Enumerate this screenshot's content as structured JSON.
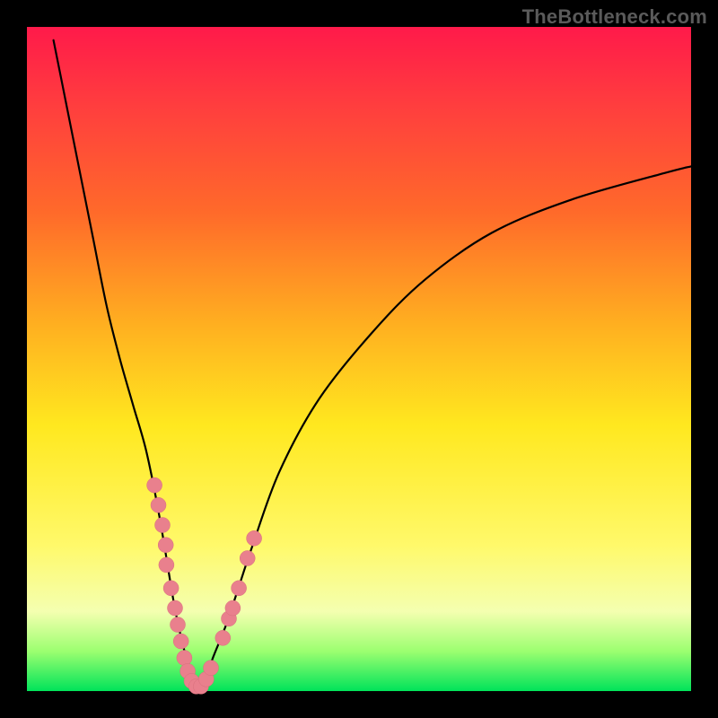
{
  "watermark": "TheBottleneck.com",
  "chart_data": {
    "type": "line",
    "title": "",
    "xlabel": "",
    "ylabel": "",
    "xlim": [
      0,
      100
    ],
    "ylim": [
      0,
      100
    ],
    "grid": false,
    "legend": false,
    "colors": {
      "background_gradient_top": "#ff1a4a",
      "background_gradient_bottom": "#00e35a",
      "curve": "#000000",
      "marker_fill": "#e9808d",
      "marker_stroke": "#d86f7c"
    },
    "series": [
      {
        "name": "bottleneck-curve",
        "x": [
          4,
          6,
          8,
          10,
          12,
          14,
          16,
          18,
          20,
          22,
          23,
          24,
          25,
          26,
          27,
          28,
          30,
          32,
          34,
          38,
          44,
          52,
          60,
          70,
          82,
          96,
          100
        ],
        "y": [
          98,
          88,
          78,
          68,
          58,
          50,
          43,
          36,
          26,
          14,
          9,
          5,
          2,
          0.5,
          2,
          5,
          10,
          16,
          22,
          33,
          44,
          54,
          62,
          69,
          74,
          78,
          79
        ]
      },
      {
        "name": "markers",
        "type": "scatter",
        "points": [
          {
            "x": 19.2,
            "y": 31
          },
          {
            "x": 19.8,
            "y": 28
          },
          {
            "x": 20.4,
            "y": 25
          },
          {
            "x": 20.9,
            "y": 22
          },
          {
            "x": 21.0,
            "y": 19
          },
          {
            "x": 21.7,
            "y": 15.5
          },
          {
            "x": 22.3,
            "y": 12.5
          },
          {
            "x": 22.7,
            "y": 10
          },
          {
            "x": 23.2,
            "y": 7.5
          },
          {
            "x": 23.7,
            "y": 5
          },
          {
            "x": 24.2,
            "y": 3
          },
          {
            "x": 24.8,
            "y": 1.5
          },
          {
            "x": 25.5,
            "y": 0.7
          },
          {
            "x": 26.2,
            "y": 0.7
          },
          {
            "x": 27.0,
            "y": 1.8
          },
          {
            "x": 27.7,
            "y": 3.5
          },
          {
            "x": 29.5,
            "y": 8
          },
          {
            "x": 30.4,
            "y": 10.9
          },
          {
            "x": 31.0,
            "y": 12.5
          },
          {
            "x": 31.9,
            "y": 15.5
          },
          {
            "x": 33.2,
            "y": 20
          },
          {
            "x": 34.2,
            "y": 23
          }
        ]
      }
    ]
  }
}
